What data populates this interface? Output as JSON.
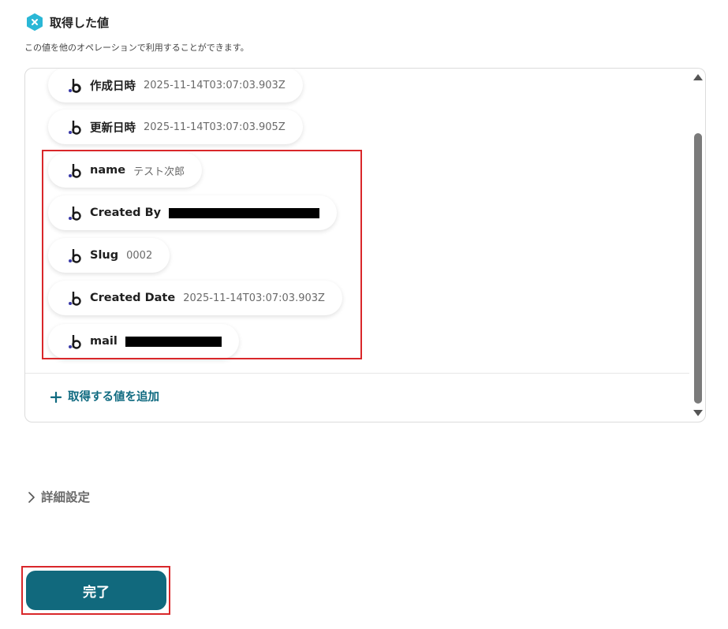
{
  "section": {
    "title": "取得した値",
    "description": "この値を他のオペレーションで利用することができます。"
  },
  "fields": [
    {
      "label": "作成日時",
      "value": "2025-11-14T03:07:03.903Z"
    },
    {
      "label": "更新日時",
      "value": "2025-11-14T03:07:03.905Z"
    },
    {
      "label": "name",
      "value": "テスト次郎"
    },
    {
      "label": "Created By",
      "value": ""
    },
    {
      "label": "Slug",
      "value": "0002"
    },
    {
      "label": "Created Date",
      "value": "2025-11-14T03:07:03.903Z"
    },
    {
      "label": "mail",
      "value": ""
    }
  ],
  "add_value_label": "取得する値を追加",
  "details_label": "詳細設定",
  "done_label": "完了",
  "colors": {
    "accent": "#11697d",
    "link": "#0f6a80",
    "highlight": "#d9272a",
    "icon_cyan": "#2ab7d6"
  },
  "icons": {
    "section": "hexagon-x-icon",
    "field": "b-logo-icon",
    "add": "plus-icon",
    "details": "chevron-right-icon"
  }
}
